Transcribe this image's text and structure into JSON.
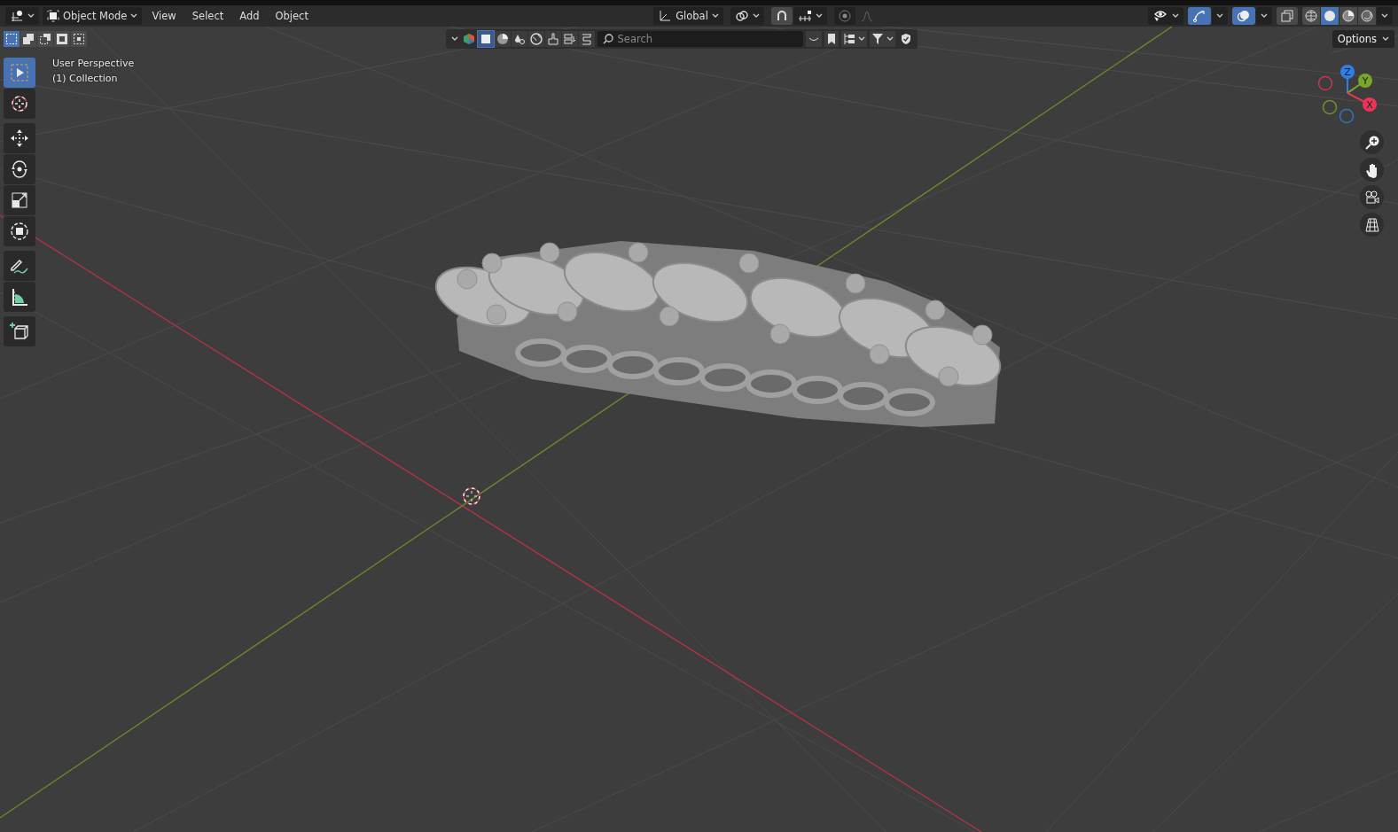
{
  "header": {
    "mode": "Object Mode",
    "menus": [
      "View",
      "Select",
      "Add",
      "Object"
    ],
    "orientation": "Global",
    "gizmos_on": true,
    "overlays_on": true,
    "shading": [
      {
        "kind": "wireframe",
        "selected": false
      },
      {
        "kind": "solid",
        "selected": true
      },
      {
        "kind": "material",
        "selected": false
      },
      {
        "kind": "rendered",
        "selected": false
      }
    ]
  },
  "select_modes": [
    {
      "kind": "new",
      "selected": true
    },
    {
      "kind": "extend",
      "selected": false
    },
    {
      "kind": "subtract",
      "selected": false
    },
    {
      "kind": "invert",
      "selected": false
    },
    {
      "kind": "intersect",
      "selected": false
    }
  ],
  "filter_bar": {
    "placeholder": "Search",
    "selectable_on": true
  },
  "options": "Options",
  "viewport": {
    "title": "User Perspective",
    "collection": "(1) Collection"
  },
  "tool_groups": [
    [
      {
        "kind": "select",
        "selected": true
      },
      {
        "kind": "cursor",
        "selected": false
      }
    ],
    [
      {
        "kind": "move",
        "selected": false
      },
      {
        "kind": "rotate",
        "selected": false
      },
      {
        "kind": "scale",
        "selected": false
      },
      {
        "kind": "transform",
        "selected": false
      }
    ],
    [
      {
        "kind": "annotate",
        "selected": false
      },
      {
        "kind": "measure",
        "selected": false
      }
    ],
    [
      {
        "kind": "add_cube",
        "selected": false
      }
    ]
  ],
  "gizmo_axes": [
    {
      "label": "Z",
      "color": "#2f80e6"
    },
    {
      "label": "Y",
      "color": "#7aa62a"
    },
    {
      "label": "X",
      "color": "#e8365a"
    }
  ]
}
